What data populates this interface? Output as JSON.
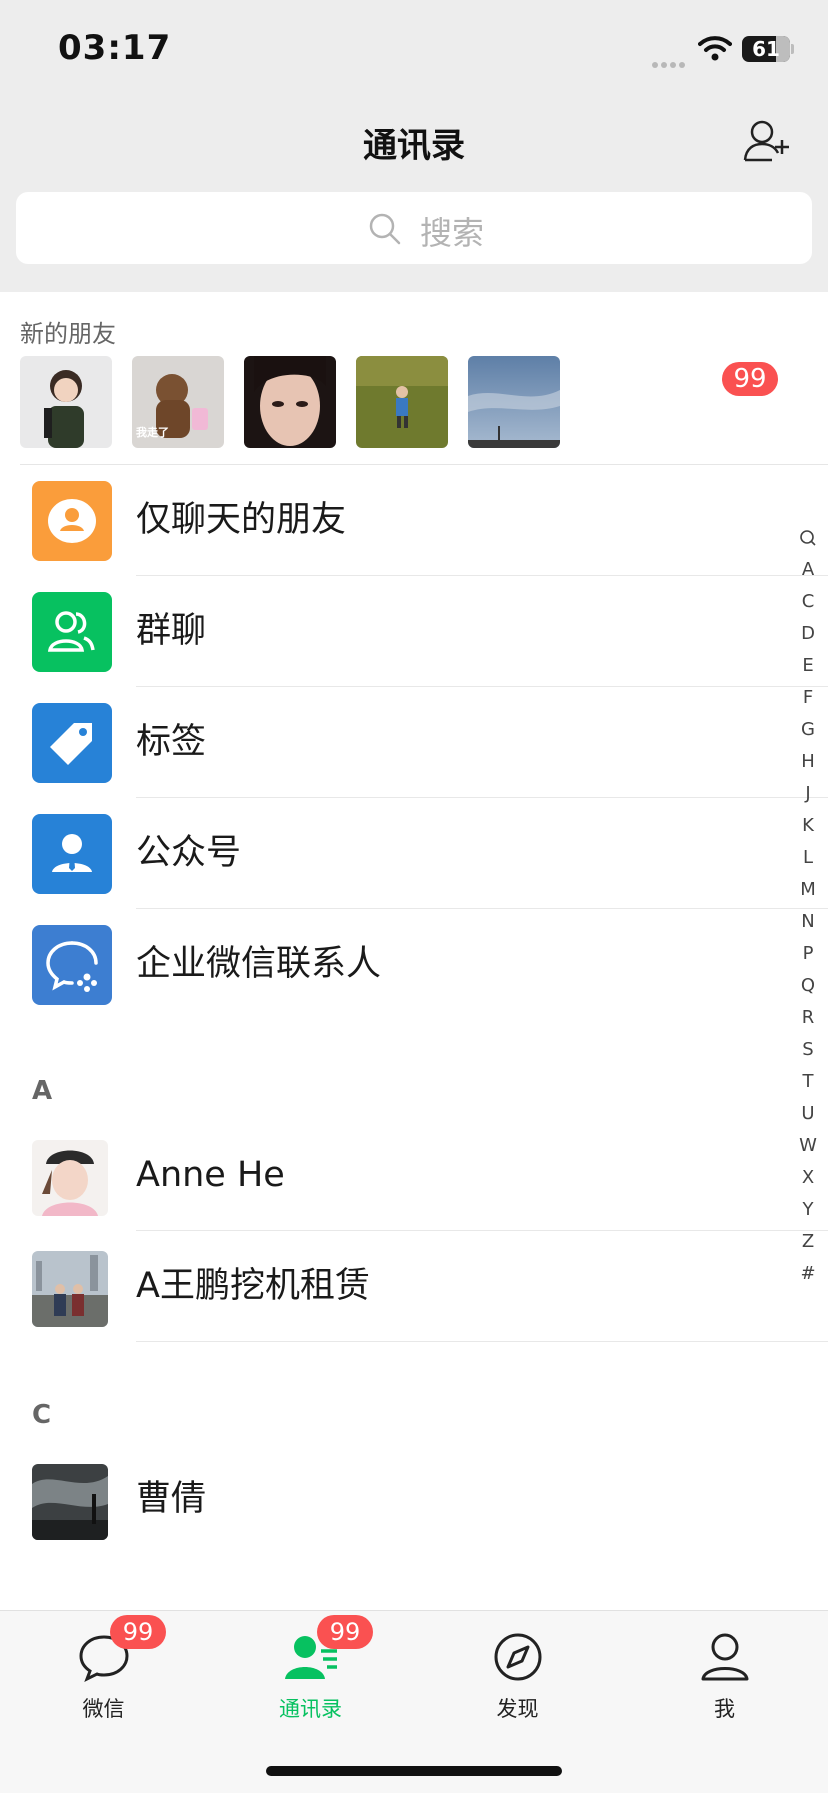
{
  "status": {
    "time": "03:17",
    "battery": "61"
  },
  "header": {
    "title": "通讯录"
  },
  "search": {
    "placeholder": "搜索"
  },
  "new_friends": {
    "title": "新的朋友",
    "badge": "99",
    "avatar_overlay_text": "我走了"
  },
  "menu": [
    {
      "label": "仅聊天的朋友",
      "color": "#fa9d3b",
      "icon": "chat-only-friends-icon"
    },
    {
      "label": "群聊",
      "color": "#07c160",
      "icon": "group-chat-icon"
    },
    {
      "label": "标签",
      "color": "#2782d7",
      "icon": "tag-icon"
    },
    {
      "label": "公众号",
      "color": "#2782d7",
      "icon": "official-account-icon"
    },
    {
      "label": "企业微信联系人",
      "color": "#3d7ed1",
      "icon": "wecom-contacts-icon"
    }
  ],
  "sections": [
    {
      "letter": "A",
      "contacts": [
        "Anne He",
        "A王鹏挖机租赁"
      ]
    },
    {
      "letter": "C",
      "contacts": [
        "曹倩"
      ]
    }
  ],
  "index": [
    "A",
    "C",
    "D",
    "E",
    "F",
    "G",
    "H",
    "J",
    "K",
    "L",
    "M",
    "N",
    "P",
    "Q",
    "R",
    "S",
    "T",
    "U",
    "W",
    "X",
    "Y",
    "Z",
    "#"
  ],
  "tabs": [
    {
      "label": "微信",
      "badge": "99",
      "active": false
    },
    {
      "label": "通讯录",
      "badge": "99",
      "active": true
    },
    {
      "label": "发现",
      "badge": "",
      "active": false
    },
    {
      "label": "我",
      "badge": "",
      "active": false
    }
  ],
  "colors": {
    "accent": "#07c160",
    "badge": "#fa5151"
  }
}
